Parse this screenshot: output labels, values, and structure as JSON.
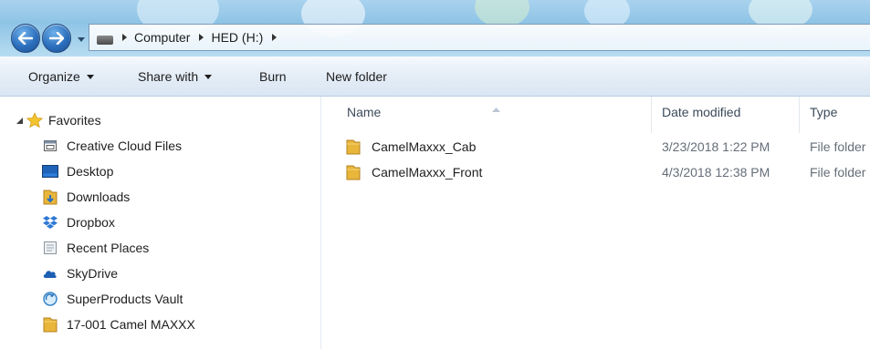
{
  "breadcrumb": [
    "Computer",
    "HED (H:)"
  ],
  "toolbar": {
    "organize": "Organize",
    "share_with": "Share with",
    "burn": "Burn",
    "new_folder": "New folder"
  },
  "navigation": {
    "favorites_label": "Favorites",
    "items": [
      {
        "label": "Creative Cloud Files",
        "icon": "creative-cloud-icon"
      },
      {
        "label": "Desktop",
        "icon": "desktop-icon"
      },
      {
        "label": "Downloads",
        "icon": "downloads-folder-icon"
      },
      {
        "label": "Dropbox",
        "icon": "dropbox-icon"
      },
      {
        "label": "Recent Places",
        "icon": "recent-places-icon"
      },
      {
        "label": "SkyDrive",
        "icon": "skydrive-icon"
      },
      {
        "label": "SuperProducts Vault",
        "icon": "vault-icon"
      },
      {
        "label": "17-001 Camel MAXXX",
        "icon": "folder-icon"
      }
    ]
  },
  "columns": {
    "name": "Name",
    "date_modified": "Date modified",
    "type": "Type"
  },
  "files": [
    {
      "name": "CamelMaxxx_Cab",
      "date": "3/23/2018 1:22 PM",
      "type": "File folder"
    },
    {
      "name": "CamelMaxxx_Front",
      "date": "4/3/2018 12:38 PM",
      "type": "File folder"
    }
  ],
  "colors": {
    "accent": "#2c6fbd",
    "folder": "#e8b63a",
    "titlebar": "#9ccbe9"
  }
}
